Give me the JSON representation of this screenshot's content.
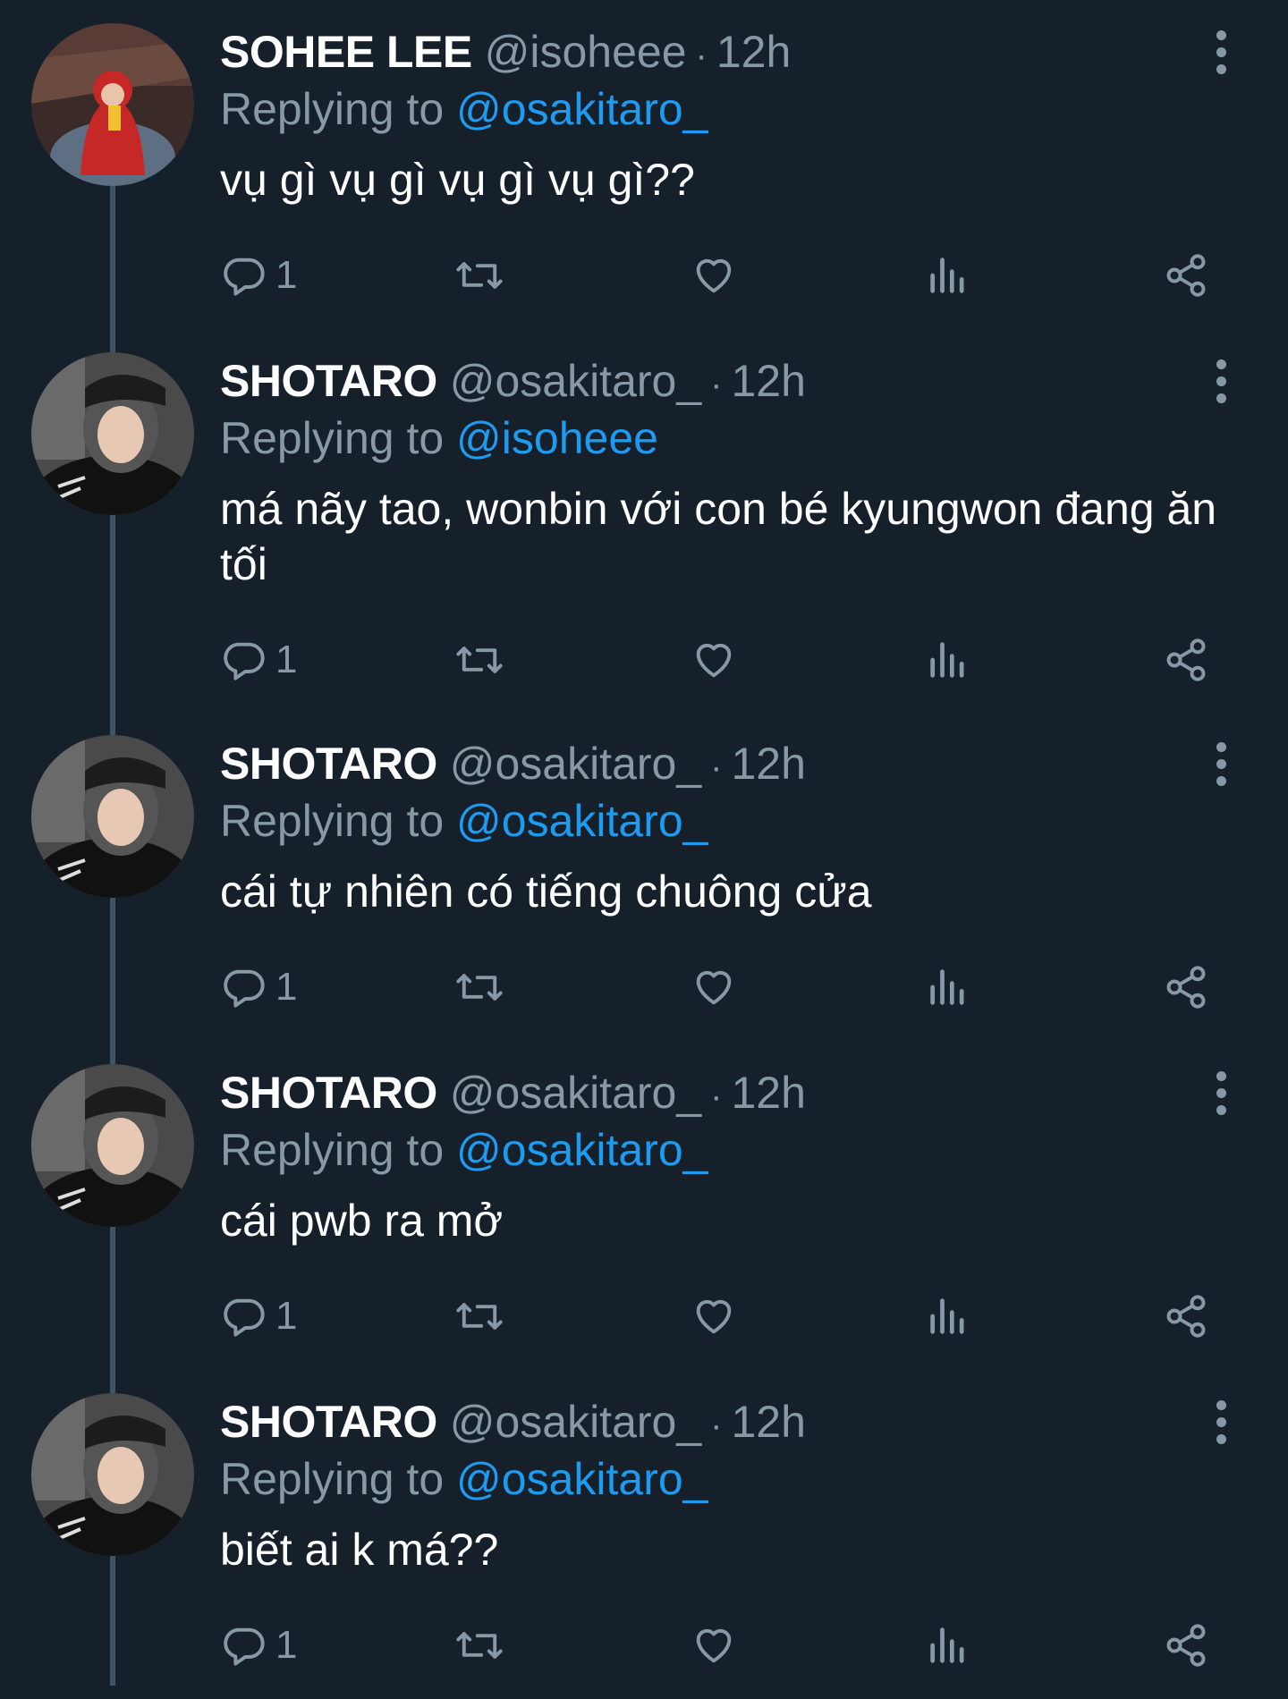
{
  "tweets": [
    {
      "name": "SOHEE LEE",
      "handle": "@isoheee",
      "separator": "·",
      "time": "12h",
      "reply_prefix": "Replying to ",
      "reply_to": "@osakitaro_",
      "text": "vụ gì vụ gì vụ gì vụ gì??",
      "reply_count": "1",
      "avatar_color": "#c62828"
    },
    {
      "name": "SHOTARO",
      "handle": "@osakitaro_",
      "separator": "·",
      "time": "12h",
      "reply_prefix": "Replying to ",
      "reply_to": "@isoheee",
      "text": "má nãy tao, wonbin với con bé kyungwon đang ăn tối",
      "reply_count": "1",
      "avatar_color": "#2a2a2a"
    },
    {
      "name": "SHOTARO",
      "handle": "@osakitaro_",
      "separator": "·",
      "time": "12h",
      "reply_prefix": "Replying to ",
      "reply_to": "@osakitaro_",
      "text": "cái tự nhiên có tiếng chuông cửa",
      "reply_count": "1",
      "avatar_color": "#2a2a2a"
    },
    {
      "name": "SHOTARO",
      "handle": "@osakitaro_",
      "separator": "·",
      "time": "12h",
      "reply_prefix": "Replying to ",
      "reply_to": "@osakitaro_",
      "text": "cái pwb ra mở",
      "reply_count": "1",
      "avatar_color": "#2a2a2a"
    },
    {
      "name": "SHOTARO",
      "handle": "@osakitaro_",
      "separator": "·",
      "time": "12h",
      "reply_prefix": "Replying to ",
      "reply_to": "@osakitaro_",
      "text": "biết ai k má??",
      "reply_count": "1",
      "avatar_color": "#2a2a2a"
    }
  ],
  "icons": {
    "reply": "reply-icon",
    "retweet": "retweet-icon",
    "like": "heart-icon",
    "analytics": "analytics-icon",
    "share": "share-icon",
    "more": "more-vertical-icon"
  },
  "colors": {
    "background": "#15202b",
    "secondary_text": "#8899a6",
    "link": "#1d9bf0",
    "thread_line": "#3d5466"
  }
}
